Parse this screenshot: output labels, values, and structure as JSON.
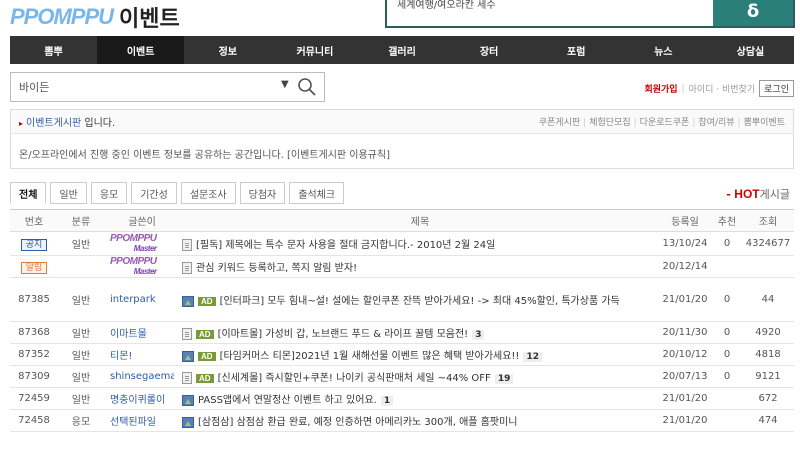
{
  "header": {
    "logo_main": "PPOMPPU",
    "logo_sub": "이벤트",
    "banner_text": "세계여행/여오라칸 세수",
    "banner_icon": "δ"
  },
  "nav": [
    {
      "label": "뽐뿌",
      "active": false
    },
    {
      "label": "이벤트",
      "active": true
    },
    {
      "label": "정보",
      "active": false
    },
    {
      "label": "커뮤니티",
      "active": false
    },
    {
      "label": "갤러리",
      "active": false
    },
    {
      "label": "장터",
      "active": false
    },
    {
      "label": "포럼",
      "active": false
    },
    {
      "label": "뉴스",
      "active": false
    },
    {
      "label": "상담실",
      "active": false
    }
  ],
  "search": {
    "value": "바이든",
    "arrow": "▼"
  },
  "login": {
    "join": "회원가입",
    "find": "아이디 · 비번찾기",
    "login_btn": "로그인"
  },
  "board": {
    "name": "이벤트게시판",
    "name_tail": " 입니다.",
    "links": [
      "쿠폰게시판",
      "체험단모집",
      "다운로드쿠폰",
      "참여/리뷰",
      "뽐뿌이벤트"
    ],
    "desc": "온/오프라인에서 진행 중인 이벤트 정보를 공유하는 공간입니다. [이벤트게시판 이용규칙]"
  },
  "tabs": [
    "전체",
    "일반",
    "응모",
    "기간성",
    "설문조사",
    "당첨자",
    "출석체크"
  ],
  "hot": {
    "dash": "-",
    "hot": "HOT",
    "label": "게시글"
  },
  "table": {
    "headers": {
      "no": "번호",
      "cat": "분류",
      "writer": "글쓴이",
      "title": "제목",
      "date": "등록일",
      "rec": "추천",
      "views": "조회"
    },
    "rows": [
      {
        "no_badge": "공지",
        "badge_type": "notice",
        "cat": "일반",
        "writer_logo": true,
        "icon": "doc",
        "ad": false,
        "title": "[필독] 제목에는 특수 문자 사용을 절대 금지합니다.- 2010년 2월 24일",
        "count": "",
        "date": "13/10/24",
        "rec": "0",
        "views": "4324677"
      },
      {
        "no_badge": "알림",
        "badge_type": "alarm",
        "cat": "",
        "writer_logo": true,
        "icon": "doc",
        "ad": false,
        "title": "관심 키워드 등록하고, 쪽지 알림 받자!",
        "count": "",
        "date": "20/12/14",
        "rec": "",
        "views": ""
      },
      {
        "no": "87385",
        "cat": "일반",
        "writer": "interpark",
        "icon": "img",
        "ad": true,
        "title": "[인터파크] 모두 힘내~설! 설에는 할인쿠폰 잔뜩 받아가세요! -> 최대 45%할인, 특가상품 가득",
        "count": "",
        "date": "21/01/20",
        "rec": "0",
        "views": "44"
      },
      {
        "no": "87368",
        "cat": "일반",
        "writer": "이마트몰",
        "icon": "doc",
        "ad": true,
        "title": "[이마트몰] 가성비 갑, 노브랜드 푸드 & 라이프 꿀템 모음전!",
        "count": "3",
        "date": "20/11/30",
        "rec": "0",
        "views": "4920"
      },
      {
        "no": "87352",
        "cat": "일반",
        "writer": "티몬!",
        "icon": "img",
        "ad": true,
        "title": "[타임커머스 티몬]2021년 1월 새해선물 이벤트 많은 혜택 받아가세요!!",
        "count": "12",
        "date": "20/10/12",
        "rec": "0",
        "views": "4818"
      },
      {
        "no": "87309",
        "cat": "일반",
        "writer": "shinsegaemall",
        "icon": "doc",
        "ad": true,
        "title": "[신세계몰] 즉시할인+쿠폰! 나이키 공식판매처 세일 ~44% OFF",
        "count": "19",
        "date": "20/07/13",
        "rec": "0",
        "views": "9121"
      },
      {
        "no": "72459",
        "cat": "일반",
        "writer": "명충이퀴롤이",
        "icon": "img",
        "ad": false,
        "title": "PASS앱에서 연말정산 이벤트 하고 있어요.",
        "count": "1",
        "date": "21/01/20",
        "rec": "",
        "views": "672"
      },
      {
        "no": "72458",
        "cat": "응모",
        "writer": "선택된파일",
        "icon": "img",
        "ad": false,
        "title": "[삼점삼] 삼점삼 환급 완료, 예정 인증하면 아메리카노 300개, 애플 홈팟미니",
        "count": "",
        "date": "21/01/20",
        "rec": "",
        "views": "474"
      }
    ]
  },
  "logo_mini": {
    "top": "PPOMPPU",
    "bottom": "Master"
  },
  "ad_label": "AD",
  "colors": {
    "nav_bg": "#333333",
    "accent_red": "#cc0000",
    "link_blue": "#2f5ca8"
  }
}
